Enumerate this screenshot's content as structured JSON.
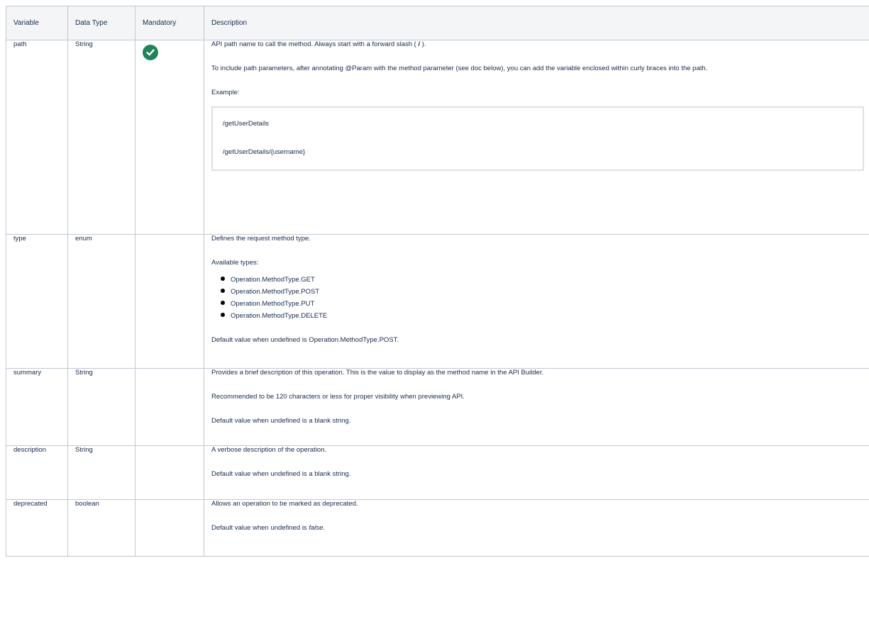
{
  "table": {
    "headers": {
      "variable": "Variable",
      "data_type": "Data Type",
      "mandatory": "Mandatory",
      "description": "Description"
    },
    "rows": [
      {
        "variable": "path",
        "data_type": "String",
        "mandatory_icon": "check-circle-icon",
        "description": {
          "p1_prefix": "API path name to call the method. Always start with a forward slash ( ",
          "p1_slash": "/",
          "p1_suffix": " ).",
          "p2": "To include path parameters, after annotating @Param with the method parameter (see doc below), you can add the variable enclosed within curly braces into the path.",
          "p3": "Example:",
          "code_line_1": "/getUserDetails",
          "code_line_2": "/getUserDetails/{username}"
        }
      },
      {
        "variable": "type",
        "data_type": "enum",
        "description": {
          "p1": "Defines the request method type.",
          "p2": "Available types:",
          "items": [
            "Operation.MethodType.GET",
            "Operation.MethodType.POST",
            "Operation.MethodType.PUT",
            "Operation.MethodType.DELETE"
          ],
          "p3": "Default value when undefined is Operation.MethodType.POST."
        }
      },
      {
        "variable": "summary",
        "data_type": "String",
        "description": {
          "p1": "Provides a brief description of this operation. This is the value to display as the method name in the API Builder.",
          "p2": "Recommended to be 120 characters or less for proper visibility when previewing API.",
          "p3": "Default value when undefined is a blank string."
        }
      },
      {
        "variable": "description",
        "data_type": "String",
        "description": {
          "p1": "A verbose description of the operation.",
          "p2": "Default value when undefined is a blank string."
        }
      },
      {
        "variable": "deprecated",
        "data_type": "boolean",
        "description": {
          "p1": "Allows an operation to be marked as deprecated.",
          "p2_prefix": "Default value when undefined is ",
          "p2_em": "false",
          "p2_suffix": "."
        }
      }
    ]
  },
  "colors": {
    "header_bg": "#f4f5f7",
    "border": "#c1c7d0",
    "check_green": "#1f845a",
    "text": "#172b4d"
  }
}
